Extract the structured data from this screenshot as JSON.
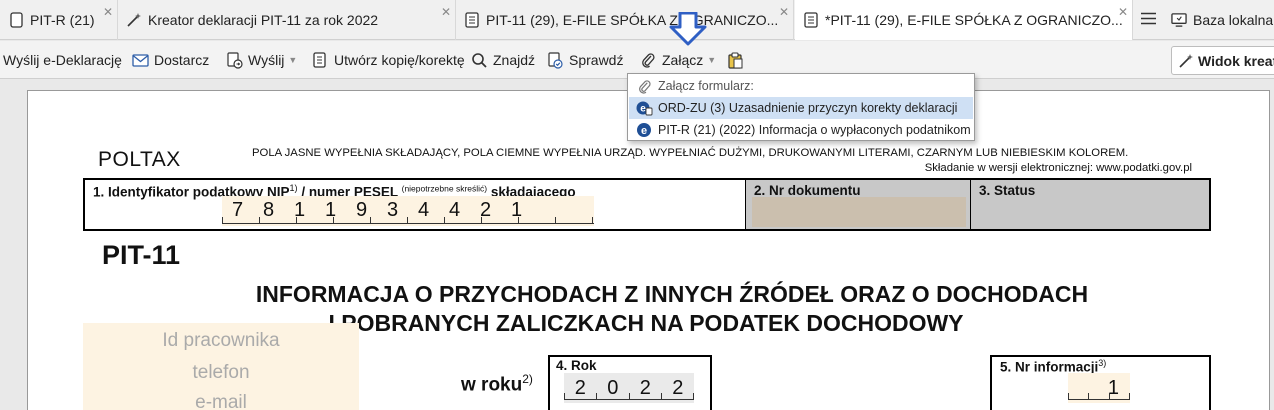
{
  "tabs": [
    {
      "label": "PIT-R (21)",
      "icon": "document-icon",
      "active": false
    },
    {
      "label": "Kreator deklaracji PIT-11 za rok 2022",
      "icon": "magic-wand-icon",
      "active": false
    },
    {
      "label": "PIT-11 (29), E-FILE SPÓŁKA Z OGRANICZO...",
      "icon": "document-icon",
      "active": false
    },
    {
      "label": "*PIT-11 (29), E-FILE SPÓŁKA Z OGRANICZO...",
      "icon": "document-icon",
      "active": true
    },
    {
      "label": "Baza lokalna",
      "icon": "monitor-icon",
      "active": false
    }
  ],
  "toolbar": {
    "send": "Wyślij e-Deklarację",
    "supplier": "Dostarcz",
    "send2": "Wyślij",
    "copy": "Utwórz kopię/korektę",
    "find": "Znajdź",
    "check": "Sprawdź",
    "attach": "Załącz",
    "view": "Widok kreatora"
  },
  "dropdown": {
    "header": "Załącz formularz:",
    "items": [
      "ORD-ZU (3) Uzasadnienie przyczyn korekty deklaracji",
      "PIT-R (21) (2022) Informacja o wypłaconych podatnikom"
    ]
  },
  "form": {
    "poltax": "POLTAX",
    "instructions": "POLA JASNE WYPEŁNIA SKŁADAJĄCY, POLA CIEMNE WYPEŁNIA URZĄD. WYPEŁNIAĆ DUŻYMI, DRUKOWANYMI LITERAMI, CZARNYM LUB NIEBIESKIM KOLOREM.",
    "instructions2": "Składanie w wersji elektronicznej: www.podatki.gov.pl",
    "field1_label_a": "1. Identyfikator podatkowy NIP",
    "field1_sup": "1)",
    "field1_label_b": " / numer PESEL ",
    "field1_small": "(niepotrzebne skreślić)",
    "field1_label_c": " składającego",
    "nip": [
      "7",
      "8",
      "1",
      "1",
      "9",
      "3",
      "4",
      "4",
      "2",
      "1"
    ],
    "field2_label": "2. Nr dokumentu",
    "field3_label": "3. Status",
    "form_code": "PIT-11",
    "title_line1": "INFORMACJA O PRZYCHODACH Z INNYCH ŹRÓDEŁ ORAZ O DOCHODACH",
    "title_line2": "I POBRANYCH ZALICZKACH NA PODATEK DOCHODOWY",
    "id_placeholder": "Id pracownika",
    "phone_placeholder": "telefon",
    "email_placeholder": "e-mail",
    "year_prefix": "w roku",
    "year_sup": "2)",
    "field4_label": "4. Rok",
    "year": [
      "2",
      "0",
      "2",
      "2"
    ],
    "field5_label": "5. Nr informacji",
    "field5_sup": "3)",
    "info_number": "1"
  },
  "colors": {
    "arrow": "#2f5fc4",
    "light_field": "#fdf3e2",
    "dark_field": "#c8c8c8",
    "highlight": "#cfe0f4"
  }
}
